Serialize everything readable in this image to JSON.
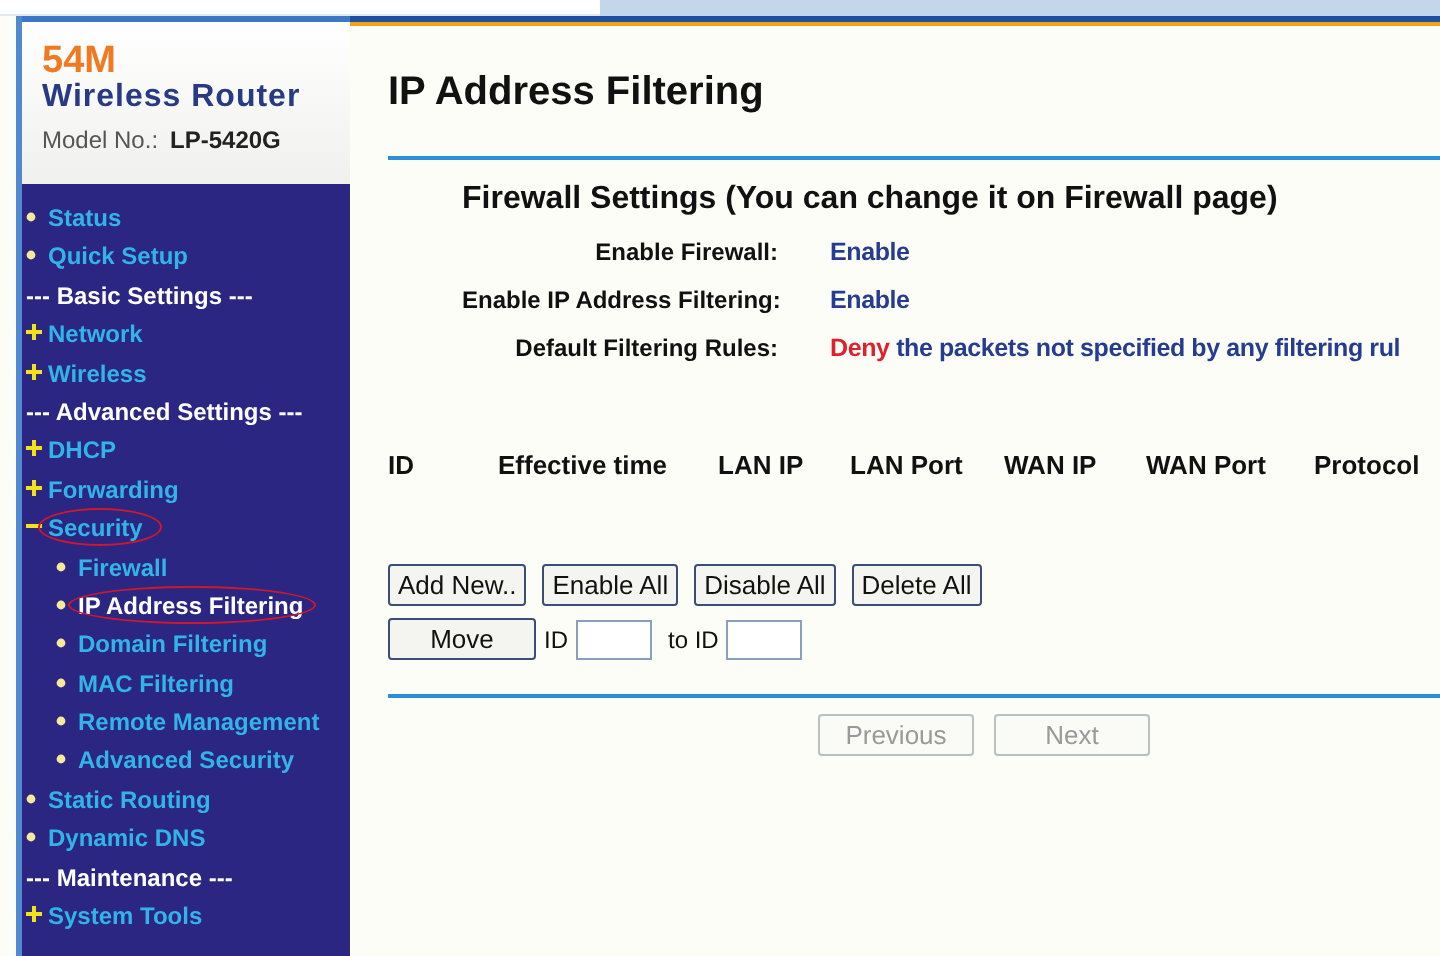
{
  "brand": {
    "speed": "54M",
    "product": "Wireless Router",
    "model_label": "Model No.:",
    "model": "LP-5420G"
  },
  "sidebar": {
    "items": [
      {
        "kind": "link",
        "label": "Status",
        "selected": false,
        "circled": false
      },
      {
        "kind": "link",
        "label": "Quick Setup",
        "selected": false,
        "circled": false
      },
      {
        "kind": "header",
        "label": "--- Basic Settings ---"
      },
      {
        "kind": "expand",
        "label": "Network",
        "selected": false,
        "circled": false
      },
      {
        "kind": "expand",
        "label": "Wireless",
        "selected": false,
        "circled": false
      },
      {
        "kind": "header",
        "label": "--- Advanced Settings ---"
      },
      {
        "kind": "expand",
        "label": "DHCP",
        "selected": false,
        "circled": false
      },
      {
        "kind": "expand",
        "label": "Forwarding",
        "selected": false,
        "circled": false
      },
      {
        "kind": "collapse",
        "label": "Security",
        "selected": false,
        "circled": true
      },
      {
        "kind": "sub",
        "label": "Firewall",
        "selected": false,
        "circled": false
      },
      {
        "kind": "sub",
        "label": "IP Address Filtering",
        "selected": true,
        "circled": true
      },
      {
        "kind": "sub",
        "label": "Domain Filtering",
        "selected": false,
        "circled": false
      },
      {
        "kind": "sub",
        "label": "MAC Filtering",
        "selected": false,
        "circled": false
      },
      {
        "kind": "sub",
        "label": "Remote Management",
        "selected": false,
        "circled": false
      },
      {
        "kind": "sub",
        "label": "Advanced Security",
        "selected": false,
        "circled": false
      },
      {
        "kind": "link",
        "label": "Static Routing",
        "selected": false,
        "circled": false
      },
      {
        "kind": "link",
        "label": "Dynamic DNS",
        "selected": false,
        "circled": false
      },
      {
        "kind": "header",
        "label": "--- Maintenance ---"
      },
      {
        "kind": "expand",
        "label": "System Tools",
        "selected": false,
        "circled": false
      }
    ]
  },
  "page": {
    "title": "IP Address Filtering",
    "firewall": {
      "heading": "Firewall Settings (You can change it on Firewall page)",
      "rows": [
        {
          "label": "Enable Firewall:",
          "value": "Enable"
        },
        {
          "label": "Enable IP Address Filtering:",
          "value": "Enable"
        },
        {
          "label": "Default Filtering Rules:",
          "highlight": "Deny",
          "value": "the packets not specified by any filtering rul"
        }
      ]
    },
    "table": {
      "columns": [
        "ID",
        "Effective time",
        "LAN IP",
        "LAN Port",
        "WAN IP",
        "WAN Port",
        "Protocol"
      ]
    },
    "actions": [
      {
        "label": "Add New.."
      },
      {
        "label": "Enable All"
      },
      {
        "label": "Disable All"
      },
      {
        "label": "Delete All"
      }
    ],
    "move": {
      "button": "Move",
      "from_label": "ID",
      "to_label": "to ID"
    },
    "pager": [
      {
        "label": "Previous",
        "disabled": true
      },
      {
        "label": "Next",
        "disabled": true
      }
    ]
  }
}
